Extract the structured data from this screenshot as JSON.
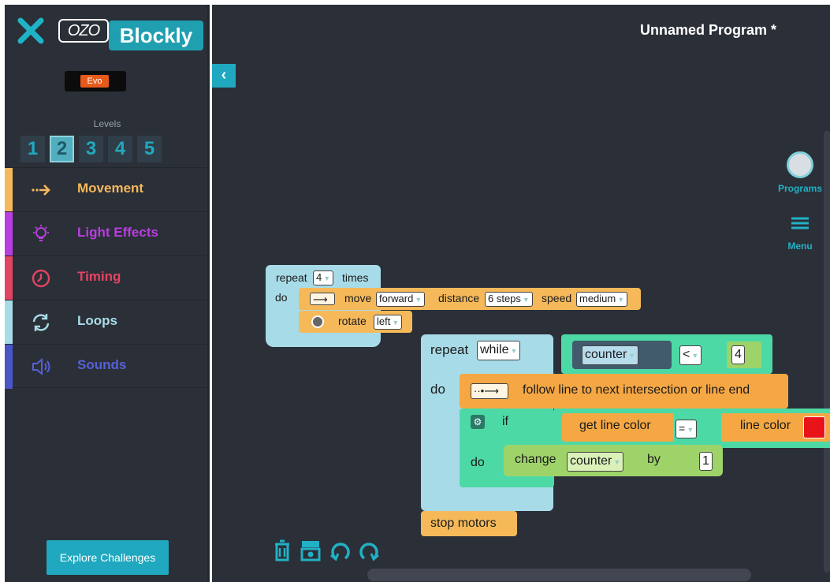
{
  "sidebar": {
    "logo_ozo": "OZO",
    "logo_blockly": "Blockly",
    "evo_badge": "Evo",
    "levels_title": "Levels",
    "levels": [
      "1",
      "2",
      "3",
      "4",
      "5"
    ],
    "active_level": "2",
    "categories": [
      {
        "label": "Movement",
        "icon": "arrow-icon",
        "color": "#f5b95a"
      },
      {
        "label": "Light Effects",
        "icon": "bulb-icon",
        "color": "#b83ee0"
      },
      {
        "label": "Timing",
        "icon": "clock-icon",
        "color": "#e34463"
      },
      {
        "label": "Loops",
        "icon": "loop-icon",
        "color": "#a8dbe8"
      },
      {
        "label": "Sounds",
        "icon": "speaker-icon",
        "color": "#4a55c8"
      }
    ],
    "explore_button": "Explore Challenges"
  },
  "header": {
    "program_title": "Unnamed Program *",
    "collapse_icon": "‹"
  },
  "side_tools": {
    "programs_label": "Programs",
    "menu_label": "Menu"
  },
  "blocks": {
    "repeat_times": {
      "prefix": "repeat",
      "count": "4",
      "suffix": "times",
      "do": "do"
    },
    "move": {
      "label": "move",
      "direction": "forward",
      "distance_label": "distance",
      "distance": "6 steps",
      "speed_label": "speed",
      "speed": "medium"
    },
    "rotate": {
      "label": "rotate",
      "direction": "left"
    },
    "repeat_while": {
      "prefix": "repeat",
      "mode": "while",
      "variable": "counter",
      "operator": "<",
      "value": "4",
      "do": "do"
    },
    "follow": {
      "label": "follow line to next intersection or line end"
    },
    "if_block": {
      "if_label": "if",
      "do": "do",
      "left": "get line color",
      "operator": "=",
      "right": "line color",
      "color": "#e8141a"
    },
    "change": {
      "label": "change",
      "variable": "counter",
      "by_label": "by",
      "value": "1"
    },
    "stop": {
      "label": "stop motors"
    }
  },
  "colors": {
    "accent": "#1fa8bf",
    "loop_block": "#a8dbe8",
    "movement_block": "#f5b95a",
    "logic_block": "#4dd9a6",
    "math_block": "#9ed36a"
  }
}
